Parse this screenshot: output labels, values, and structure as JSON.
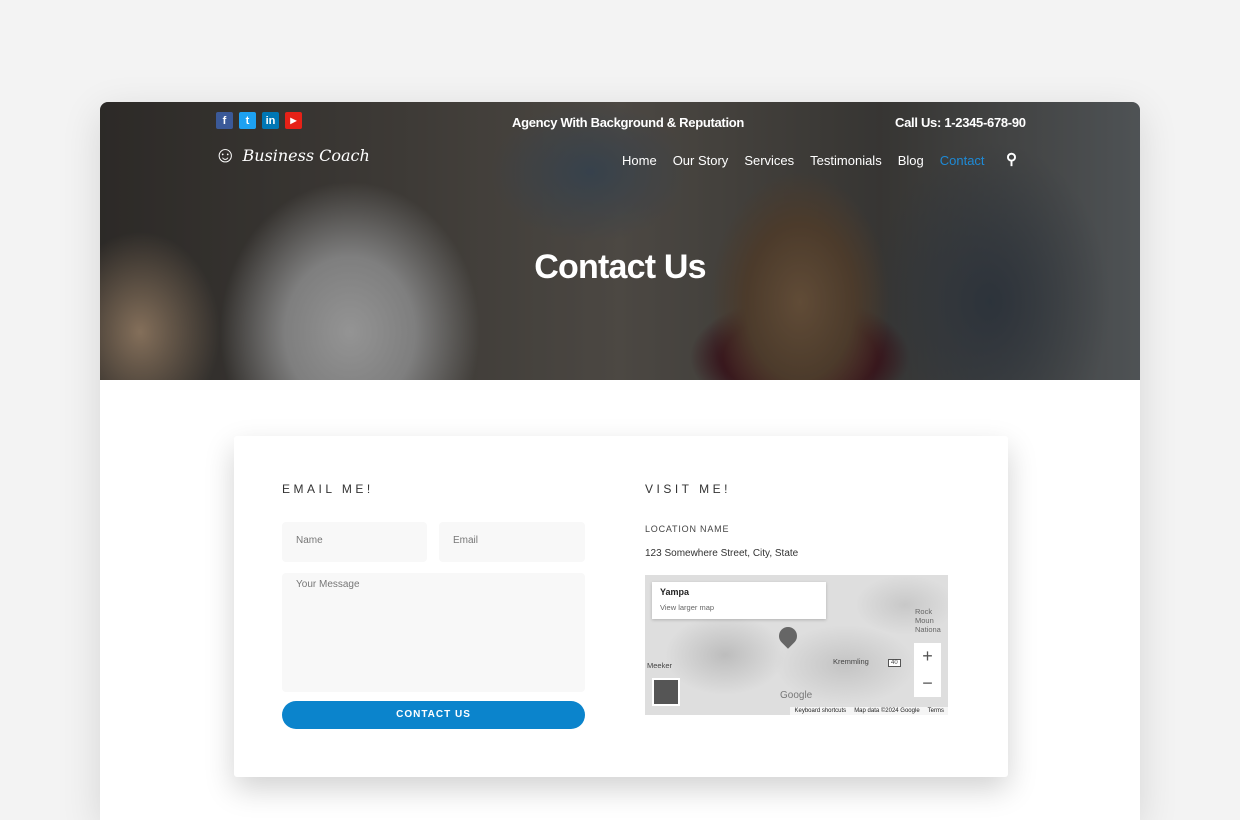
{
  "header": {
    "social": [
      {
        "icon": "facebook-icon",
        "glyph": "f",
        "color": "#3b5998"
      },
      {
        "icon": "twitter-icon",
        "glyph": "t",
        "color": "#1da1f2"
      },
      {
        "icon": "linkedin-icon",
        "glyph": "in",
        "color": "#0077b5"
      },
      {
        "icon": "youtube-icon",
        "glyph": "▶",
        "color": "#e62117"
      }
    ],
    "tagline": "Agency With Background & Reputation",
    "phone": "Call Us: 1-2345-678-90",
    "logo_text": "Business Coach",
    "nav": [
      "Home",
      "Our Story",
      "Services",
      "Testimonials",
      "Blog",
      "Contact"
    ],
    "active_nav": "Contact",
    "accent": "#1e8ad6"
  },
  "hero": {
    "title": "Contact Us"
  },
  "email": {
    "heading": "EMAIL ME!",
    "name_placeholder": "Name",
    "email_placeholder": "Email",
    "message_placeholder": "Your Message",
    "button": "CONTACT US",
    "button_color": "#0b84cc"
  },
  "visit": {
    "heading": "VISIT ME!",
    "location_label": "LOCATION NAME",
    "address": "123 Somewhere Street, City, State",
    "map": {
      "place": "Yampa",
      "larger_link": "View larger map",
      "labels": {
        "meeker": "Meeker",
        "kremmling": "Kremmling",
        "rocky": "Rock Moun Nationa",
        "route": "40",
        "google": "Google"
      },
      "zoom_in": "+",
      "zoom_out": "−",
      "footer": [
        "Keyboard shortcuts",
        "Map data ©2024 Google",
        "Terms"
      ]
    }
  }
}
